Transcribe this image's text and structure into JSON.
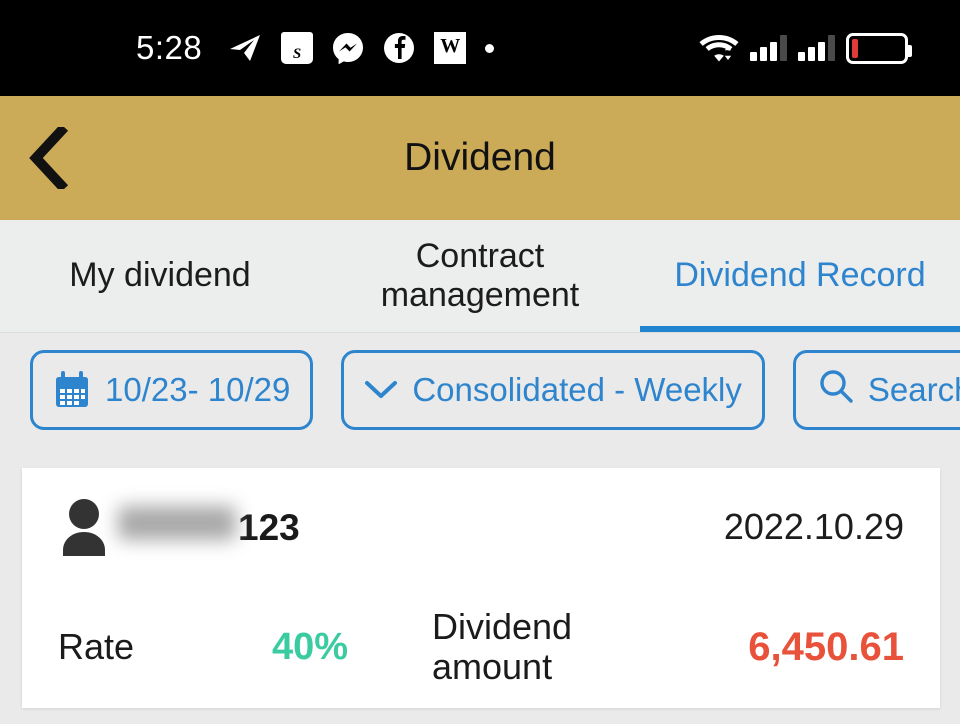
{
  "statusbar": {
    "time": "5:28",
    "icons": [
      {
        "name": "telegram-icon",
        "glyph": "➤"
      },
      {
        "name": "shopee-icon",
        "glyph": "S"
      },
      {
        "name": "messenger-icon",
        "glyph": "⚡"
      },
      {
        "name": "facebook-icon",
        "glyph": "f"
      },
      {
        "name": "wikipedia-icon",
        "glyph": "W"
      },
      {
        "name": "more-notifications-icon",
        "glyph": "•"
      }
    ],
    "right_icons": [
      "wifi-icon",
      "signal-sim1-icon",
      "signal-sim2-icon",
      "battery-low-icon"
    ],
    "battery_level": "12%"
  },
  "header": {
    "title": "Dividend",
    "back_label": "Back",
    "bg_color": "#cbab57"
  },
  "tabs": [
    {
      "label": "My dividend",
      "active": false
    },
    {
      "label": "Contract\nmanagement",
      "line1": "Contract",
      "line2": "management",
      "active": false
    },
    {
      "label": "Dividend Record",
      "active": true
    }
  ],
  "filters": {
    "date_range": "10/23- 10/29",
    "period": "Consolidated - Weekly",
    "search_label": "Search",
    "accent_color": "#2e85ce"
  },
  "record": {
    "username_visible": "123",
    "username_redacted": true,
    "date": "2022.10.29",
    "rate_label": "Rate",
    "rate_value": "40%",
    "rate_color": "#3acca0",
    "amount_label_line1": "Dividend",
    "amount_label_line2": "amount",
    "amount_value": "6,450.61",
    "amount_color": "#e8513a"
  }
}
